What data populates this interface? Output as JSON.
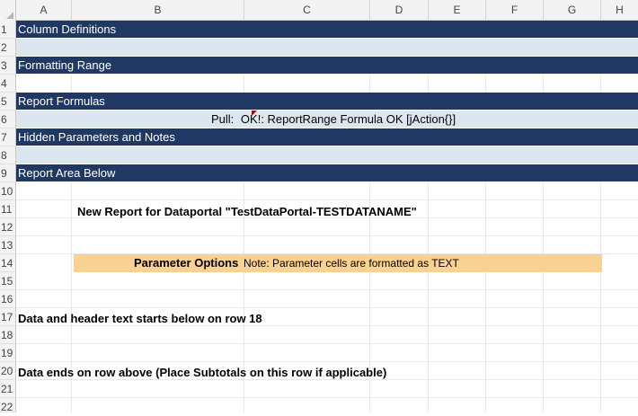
{
  "columns": [
    "A",
    "B",
    "C",
    "D",
    "E",
    "F",
    "G",
    "H"
  ],
  "rows": [
    "1",
    "2",
    "3",
    "4",
    "5",
    "6",
    "7",
    "8",
    "9",
    "10",
    "11",
    "12",
    "13",
    "14",
    "15",
    "16",
    "17",
    "18",
    "19",
    "20",
    "21",
    "22"
  ],
  "bands": {
    "row1": "Column Definitions",
    "row3": "Formatting Range",
    "row5": "Report Formulas",
    "row7": "Hidden Parameters and Notes",
    "row9": "Report Area Below"
  },
  "row6": {
    "label": "Pull:",
    "value": "OK!: ReportRange Formula OK [jAction{}]"
  },
  "row11": {
    "title": "New Report for Dataportal \"TestDataPortal-TESTDATANAME\""
  },
  "row14": {
    "title": "Parameter Options",
    "note": "Note: Parameter cells are formatted as TEXT"
  },
  "row17": {
    "text": "Data and header text starts below on row 18"
  },
  "row20": {
    "text": "Data ends on row above (Place Subtotals on this row if applicable)"
  },
  "colors": {
    "band_dark": "#203864",
    "band_light": "#dce6f1",
    "parameter_fill": "#f8d193",
    "comment_marker": "#c00000"
  }
}
